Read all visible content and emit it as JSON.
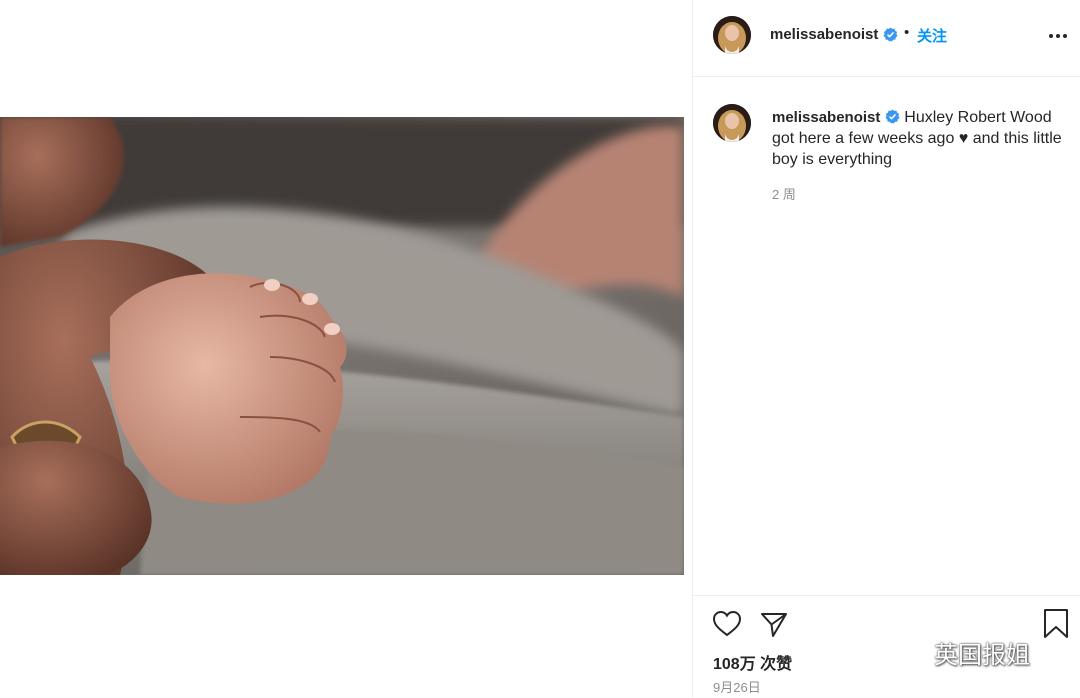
{
  "post": {
    "username": "melissabenoist",
    "follow_label": "关注",
    "separator": "•",
    "caption": "Huxley Robert Wood got here a few weeks ago ♥ and this little boy is everything",
    "time_ago": "2 周",
    "likes": "108万 次赞",
    "date": "9月26日"
  },
  "icons": {
    "verified": "verified-badge-icon",
    "more": "more-options-icon",
    "like": "heart-outline-icon",
    "share": "paper-plane-icon",
    "save": "bookmark-icon",
    "wechat": "wechat-icon"
  },
  "watermark": {
    "text": "英国报姐"
  },
  "colors": {
    "accent": "#0095f6",
    "text": "#262626",
    "muted": "#8e8e8e",
    "divider": "#efefef"
  }
}
